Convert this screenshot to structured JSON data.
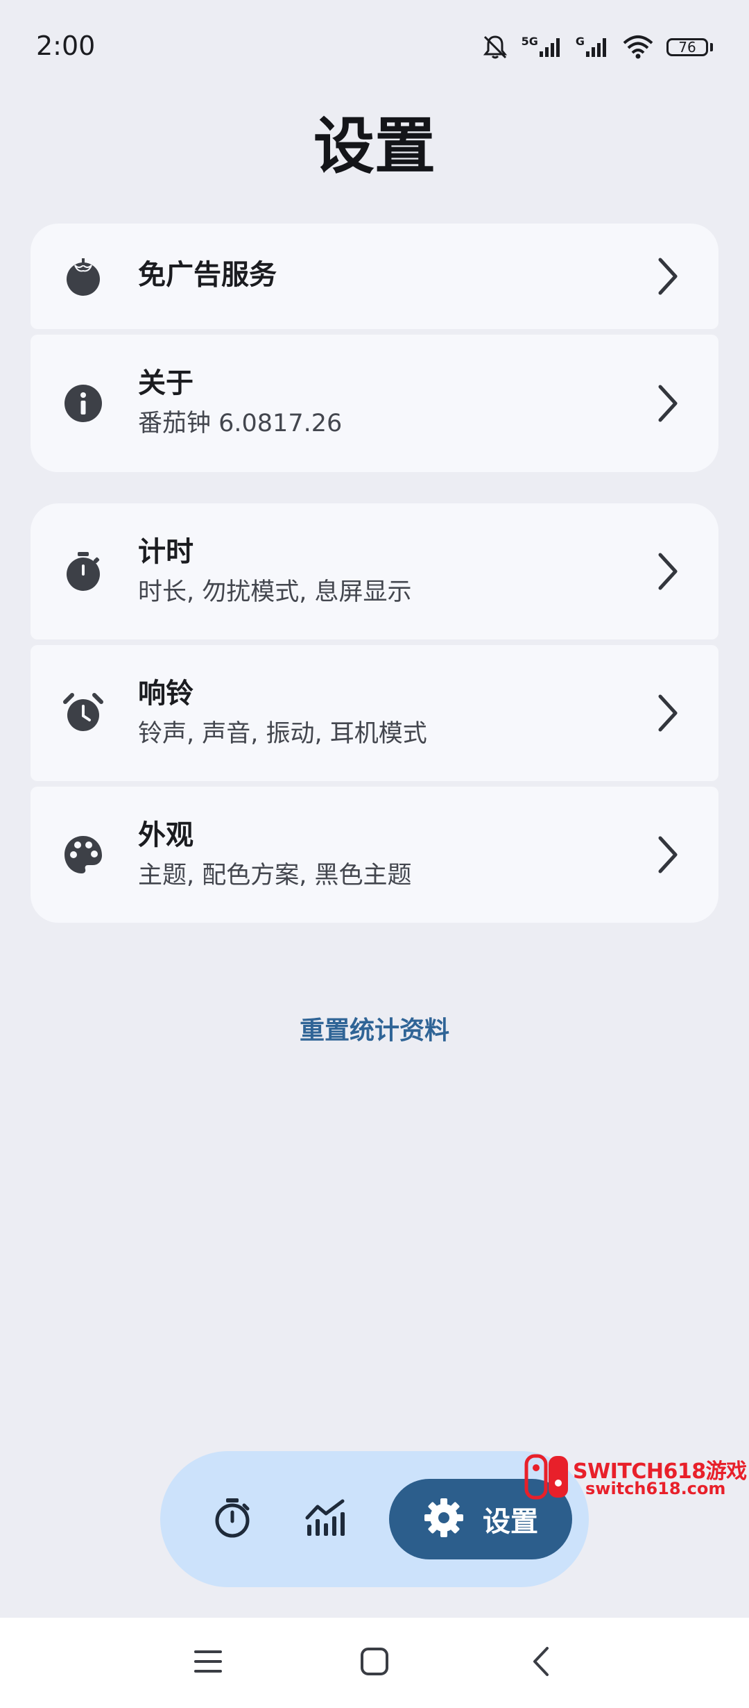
{
  "status_bar": {
    "time": "2:00",
    "network_1": "5G",
    "network_2": "G",
    "battery_level": "76"
  },
  "page": {
    "title": "设置"
  },
  "settings": {
    "ad_free": {
      "title": "免广告服务",
      "icon": "tomato-icon"
    },
    "about": {
      "title": "关于",
      "subtitle": "番茄钟 6.0817.26",
      "icon": "info-icon"
    },
    "timing": {
      "title": "计时",
      "subtitle": "时长, 勿扰模式, 息屏显示",
      "icon": "stopwatch-icon"
    },
    "ringing": {
      "title": "响铃",
      "subtitle": "铃声, 声音, 振动, 耳机模式",
      "icon": "alarm-clock-icon"
    },
    "appearance": {
      "title": "外观",
      "subtitle": "主题, 配色方案, 黑色主题",
      "icon": "palette-icon"
    }
  },
  "reset_link": "重置统计资料",
  "tab_bar": {
    "settings_label": "设置"
  },
  "watermark": {
    "title": "SWITCH618游戏",
    "url": "switch618.com"
  },
  "colors": {
    "background": "#ECEDF3",
    "card": "#F7F8FC",
    "accent": "#2C5E8C",
    "tab_bar": "#CCE2FB",
    "link": "#2F6496",
    "watermark": "#E8202A"
  }
}
